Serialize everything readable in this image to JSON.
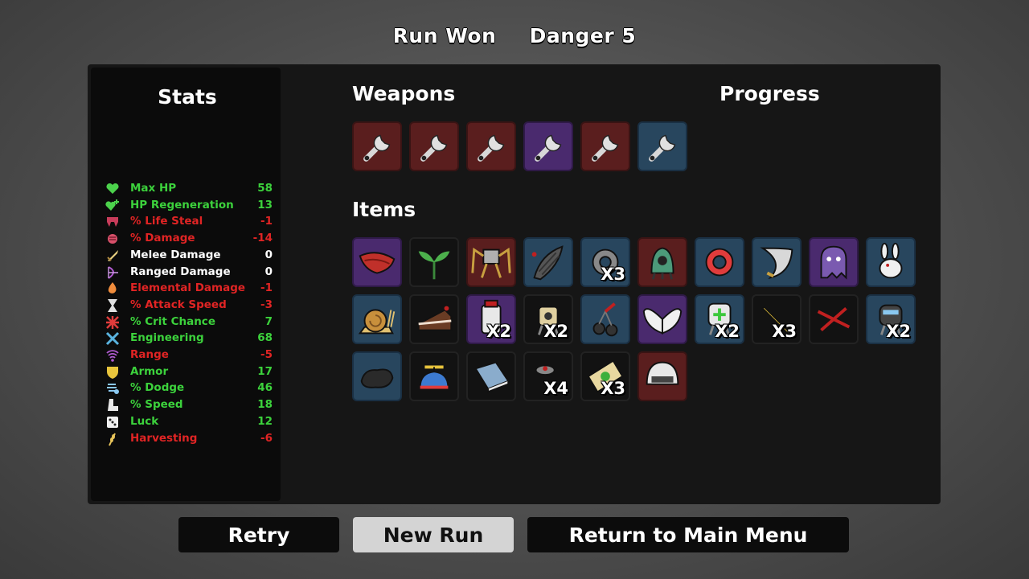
{
  "header": {
    "result": "Run Won",
    "danger": "Danger 5"
  },
  "stats": {
    "title": "Stats",
    "rows": [
      {
        "label": "Max HP",
        "value": "58",
        "color": "#3cd23c",
        "icon": "heart-icon"
      },
      {
        "label": "HP Regeneration",
        "value": "13",
        "color": "#3cd23c",
        "icon": "heart-plus-icon"
      },
      {
        "label": "% Life Steal",
        "value": "-1",
        "color": "#e02424",
        "icon": "fangs-icon"
      },
      {
        "label": "% Damage",
        "value": "-14",
        "color": "#e02424",
        "icon": "fist-icon"
      },
      {
        "label": "Melee Damage",
        "value": "0",
        "color": "#ffffff",
        "icon": "sword-icon"
      },
      {
        "label": "Ranged Damage",
        "value": "0",
        "color": "#ffffff",
        "icon": "bow-icon"
      },
      {
        "label": "Elemental Damage",
        "value": "-1",
        "color": "#e02424",
        "icon": "flame-icon"
      },
      {
        "label": "% Attack Speed",
        "value": "-3",
        "color": "#e02424",
        "icon": "hourglass-icon"
      },
      {
        "label": "% Crit Chance",
        "value": "7",
        "color": "#3cd23c",
        "icon": "crit-icon"
      },
      {
        "label": "Engineering",
        "value": "68",
        "color": "#3cd23c",
        "icon": "wrench-cross-icon"
      },
      {
        "label": "Range",
        "value": "-5",
        "color": "#e02424",
        "icon": "signal-icon"
      },
      {
        "label": "Armor",
        "value": "17",
        "color": "#3cd23c",
        "icon": "shield-icon"
      },
      {
        "label": "% Dodge",
        "value": "46",
        "color": "#3cd23c",
        "icon": "dodge-icon"
      },
      {
        "label": "% Speed",
        "value": "18",
        "color": "#3cd23c",
        "icon": "boot-icon"
      },
      {
        "label": "Luck",
        "value": "12",
        "color": "#3cd23c",
        "icon": "dice-icon"
      },
      {
        "label": "Harvesting",
        "value": "-6",
        "color": "#e02424",
        "icon": "wheat-icon"
      }
    ]
  },
  "weapons": {
    "title": "Weapons",
    "slots": [
      {
        "tier": "red",
        "icon": "wrench-icon"
      },
      {
        "tier": "red",
        "icon": "wrench-icon"
      },
      {
        "tier": "red",
        "icon": "wrench-icon"
      },
      {
        "tier": "purple",
        "icon": "wrench-icon"
      },
      {
        "tier": "red",
        "icon": "wrench-icon"
      },
      {
        "tier": "blue",
        "icon": "wrench-icon"
      }
    ]
  },
  "progress": {
    "title": "Progress"
  },
  "items": {
    "title": "Items",
    "slots": [
      {
        "tier": "purple",
        "icon": "bandana-icon",
        "qty": ""
      },
      {
        "tier": "black",
        "icon": "sprout-icon",
        "qty": ""
      },
      {
        "tier": "red",
        "icon": "robot-spider-icon",
        "qty": ""
      },
      {
        "tier": "blue",
        "icon": "leech-icon",
        "qty": ""
      },
      {
        "tier": "blue",
        "icon": "gear-icon",
        "qty": "X3"
      },
      {
        "tier": "red",
        "icon": "alien-pod-icon",
        "qty": ""
      },
      {
        "tier": "blue",
        "icon": "ring-icon",
        "qty": ""
      },
      {
        "tier": "blue",
        "icon": "blade-icon",
        "qty": ""
      },
      {
        "tier": "purple",
        "icon": "ghost-icon",
        "qty": ""
      },
      {
        "tier": "blue",
        "icon": "rabbit-icon",
        "qty": ""
      },
      {
        "tier": "blue",
        "icon": "snail-icon",
        "qty": ""
      },
      {
        "tier": "black",
        "icon": "cake-icon",
        "qty": ""
      },
      {
        "tier": "purple",
        "icon": "jar-icon",
        "qty": "X2"
      },
      {
        "tier": "black",
        "icon": "turret-icon",
        "qty": "X2"
      },
      {
        "tier": "blue",
        "icon": "cherry-bomb-icon",
        "qty": ""
      },
      {
        "tier": "purple",
        "icon": "wings-icon",
        "qty": ""
      },
      {
        "tier": "blue",
        "icon": "medic-turret-icon",
        "qty": "X2"
      },
      {
        "tier": "black",
        "icon": "pencil-icon",
        "qty": "X3"
      },
      {
        "tier": "black",
        "icon": "cross-scratch-icon",
        "qty": ""
      },
      {
        "tier": "blue",
        "icon": "robot-icon",
        "qty": "X2"
      },
      {
        "tier": "blue",
        "icon": "rock-icon",
        "qty": ""
      },
      {
        "tier": "black",
        "icon": "propeller-hat-icon",
        "qty": ""
      },
      {
        "tier": "black",
        "icon": "book-icon",
        "qty": ""
      },
      {
        "tier": "black",
        "icon": "landmine-icon",
        "qty": "X4"
      },
      {
        "tier": "black",
        "icon": "cash-icon",
        "qty": "X3"
      },
      {
        "tier": "red",
        "icon": "helmet-icon",
        "qty": ""
      }
    ]
  },
  "buttons": {
    "retry": "Retry",
    "new_run": "New Run",
    "main_menu": "Return to Main Menu"
  }
}
